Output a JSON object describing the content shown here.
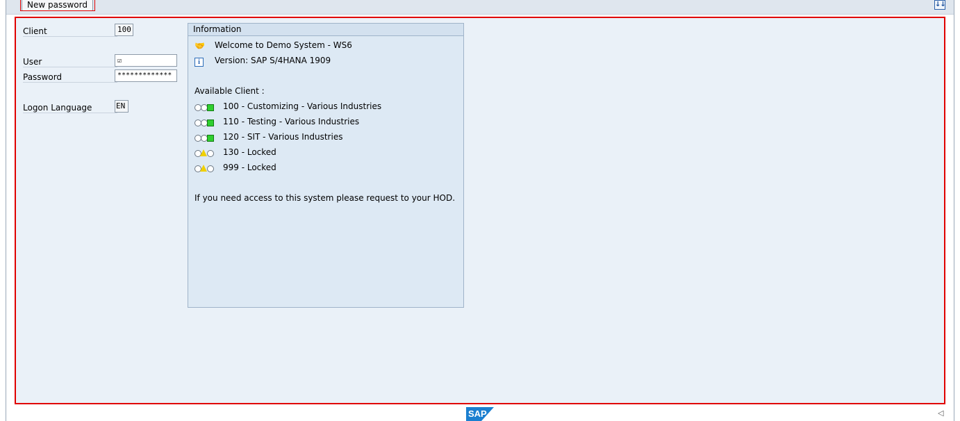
{
  "toolbar": {
    "new_password_label": "New password",
    "scroll_icon": "sort-icon"
  },
  "form": {
    "client_label": "Client",
    "client_value": "100",
    "user_label": "User",
    "user_value": "",
    "password_label": "Password",
    "password_value": "*************",
    "language_label": "Logon Language",
    "language_value": "EN"
  },
  "info": {
    "header": "Information",
    "welcome": "Welcome to Demo System - WS6",
    "version": "Version: SAP S/4HANA 1909",
    "available_label": "Available Client :",
    "clients": [
      {
        "text": "100 - Customizing - Various Industries",
        "status": "green"
      },
      {
        "text": "110 - Testing - Various Industries",
        "status": "green"
      },
      {
        "text": "120 - SIT - Various Industries",
        "status": "green"
      },
      {
        "text": "130 - Locked",
        "status": "yellow"
      },
      {
        "text": "999 - Locked",
        "status": "yellow"
      }
    ],
    "footer": "If you need access to this system please request to your HOD."
  },
  "footer": {
    "logo_text": "SAP"
  },
  "colors": {
    "focus_border": "#e00000",
    "panel_bg": "#dde9f4",
    "main_bg": "#eaf1f8"
  }
}
